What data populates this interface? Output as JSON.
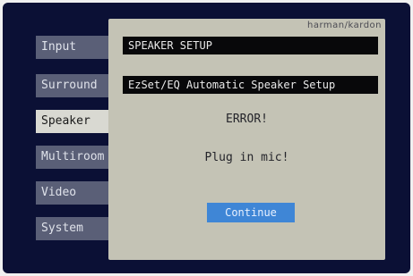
{
  "menu": {
    "items": [
      {
        "label": "Input"
      },
      {
        "label": "Surround"
      },
      {
        "label": "Speaker",
        "selected": true
      },
      {
        "label": "Multiroom"
      },
      {
        "label": "Video"
      },
      {
        "label": "System"
      }
    ]
  },
  "panel": {
    "brand": "harman/kardon",
    "title": "SPEAKER SETUP",
    "subtitle": "EzSet/EQ Automatic Speaker Setup",
    "error": "ERROR!",
    "message": "Plug in mic!",
    "continue_label": "Continue"
  },
  "colors": {
    "screen_bg": "#0b1035",
    "panel_bg": "#c4c3b5",
    "menu_item_bg": "#5a5f77",
    "menu_selected_bg": "#d9d9d2",
    "button_bg": "#3f86d6"
  }
}
